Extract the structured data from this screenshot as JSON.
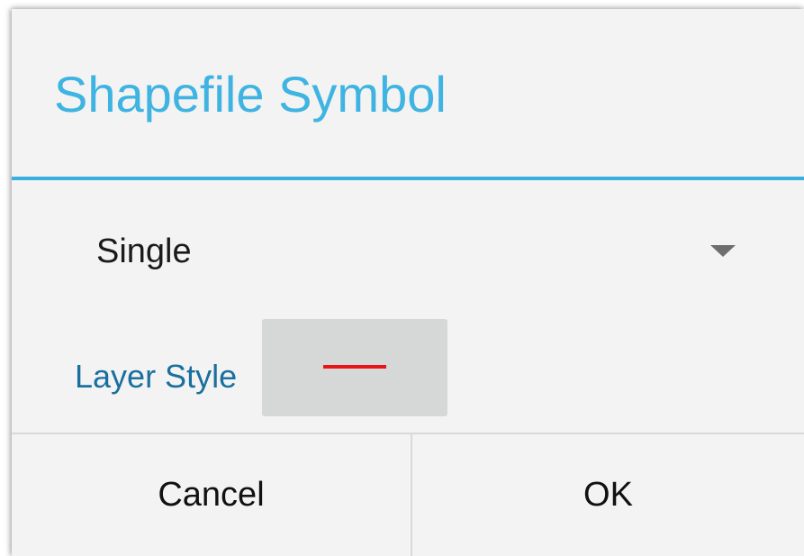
{
  "dialog": {
    "title": "Shapefile Symbol"
  },
  "symbol_type": {
    "selected": "Single",
    "icon": "dropdown-arrow-icon"
  },
  "layer_style": {
    "label": "Layer Style",
    "swatch_color": "#e8141a",
    "swatch_icon": "line-symbol-icon"
  },
  "colors": {
    "title": "#3fb4e2",
    "accent_divider": "#37b0e0",
    "label": "#1a6f9e",
    "button_bg": "#d6d8d8",
    "dialog_bg": "#f3f3f3"
  },
  "buttons": {
    "cancel_label": "Cancel",
    "ok_label": "OK"
  }
}
